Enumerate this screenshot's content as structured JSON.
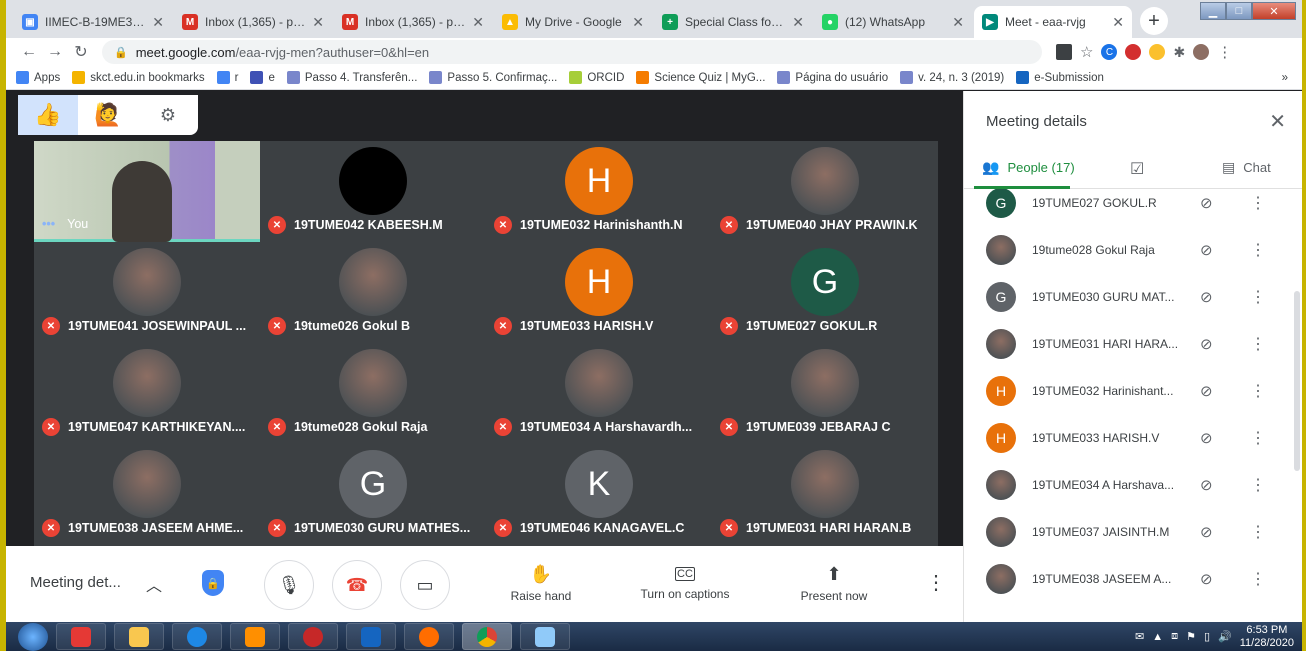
{
  "tabs": [
    {
      "label": "IIMEC-B-19ME302-",
      "color": "#4285f4",
      "glyph": "▣"
    },
    {
      "label": "Inbox (1,365) - prin",
      "color": "#d93025",
      "glyph": "M"
    },
    {
      "label": "Inbox (1,365) - prin",
      "color": "#d93025",
      "glyph": "M"
    },
    {
      "label": "My Drive - Google",
      "color": "#fbbc04",
      "glyph": "▲"
    },
    {
      "label": "Special Class for La",
      "color": "#0f9d58",
      "glyph": "+"
    },
    {
      "label": "(12) WhatsApp",
      "color": "#25d366",
      "glyph": "●"
    },
    {
      "label": "Meet - eaa-rvjg",
      "color": "#00897b",
      "glyph": "▶"
    }
  ],
  "address": {
    "host": "meet.google.com",
    "path": "/eaa-rvjg-men?authuser=0&hl=en"
  },
  "bookmarks": [
    {
      "label": "Apps",
      "color": "#4285f4"
    },
    {
      "label": "skct.edu.in bookmarks",
      "color": "#f4b400"
    },
    {
      "label": "r",
      "color": "#4285f4"
    },
    {
      "label": "e",
      "color": "#3f51b5"
    },
    {
      "label": "Passo 4. Transferên...",
      "color": "#7986cb"
    },
    {
      "label": "Passo 5. Confirmaç...",
      "color": "#7986cb"
    },
    {
      "label": "ORCID",
      "color": "#a6ce39"
    },
    {
      "label": "Science Quiz | MyG...",
      "color": "#f57c00"
    },
    {
      "label": "Página do usuário",
      "color": "#7986cb"
    },
    {
      "label": "v. 24, n. 3 (2019)",
      "color": "#7986cb"
    },
    {
      "label": "e-Submission",
      "color": "#1565c0"
    }
  ],
  "bookmarks_more": "»",
  "self_tile": {
    "label": "You",
    "dots": "•••"
  },
  "tiles": [
    {
      "name": "19TUME042 KABEESH.M",
      "avatar": "",
      "color": "#000000",
      "photo": false
    },
    {
      "name": "19TUME032 Harinishanth.N",
      "avatar": "H",
      "color": "#e8710a",
      "photo": false
    },
    {
      "name": "19TUME040 JHAY PRAWIN.K",
      "avatar": "",
      "color": "",
      "photo": true
    },
    {
      "name": "19TUME041 JOSEWINPAUL ...",
      "avatar": "",
      "color": "",
      "photo": true
    },
    {
      "name": "19tume026 Gokul B",
      "avatar": "",
      "color": "",
      "photo": true
    },
    {
      "name": "19TUME033 HARISH.V",
      "avatar": "H",
      "color": "#e8710a",
      "photo": false
    },
    {
      "name": "19TUME027 GOKUL.R",
      "avatar": "G",
      "color": "#1e5a47",
      "photo": false
    },
    {
      "name": "19TUME047 KARTHIKEYAN....",
      "avatar": "",
      "color": "",
      "photo": true
    },
    {
      "name": "19tume028 Gokul Raja",
      "avatar": "",
      "color": "",
      "photo": true
    },
    {
      "name": "19TUME034 A Harshavardh...",
      "avatar": "",
      "color": "",
      "photo": true
    },
    {
      "name": "19TUME039 JEBARAJ C",
      "avatar": "",
      "color": "",
      "photo": true
    },
    {
      "name": "19TUME038 JASEEM AHME...",
      "avatar": "",
      "color": "",
      "photo": true
    },
    {
      "name": "19TUME030 GURU MATHES...",
      "avatar": "G",
      "color": "#5f6368",
      "photo": false
    },
    {
      "name": "19TUME046 KANAGAVEL.C",
      "avatar": "K",
      "color": "#5f6368",
      "photo": false
    },
    {
      "name": "19TUME031 HARI HARAN.B",
      "avatar": "",
      "color": "",
      "photo": true
    }
  ],
  "controls": {
    "meeting_details": "Meeting det...",
    "raise_hand": "Raise hand",
    "captions": "Turn on captions",
    "present": "Present now"
  },
  "panel": {
    "title": "Meeting details",
    "people_tab": "People (17)",
    "chat_tab": "Chat",
    "people": [
      {
        "name": "19TUME027 GOKUL.R",
        "avatar": "G",
        "color": "#1e5a47",
        "photo": false
      },
      {
        "name": "19tume028 Gokul Raja",
        "avatar": "",
        "color": "",
        "photo": true
      },
      {
        "name": "19TUME030 GURU MAT...",
        "avatar": "G",
        "color": "#5f6368",
        "photo": false
      },
      {
        "name": "19TUME031 HARI HARA...",
        "avatar": "",
        "color": "",
        "photo": true
      },
      {
        "name": "19TUME032 Harinishant...",
        "avatar": "H",
        "color": "#e8710a",
        "photo": false
      },
      {
        "name": "19TUME033 HARISH.V",
        "avatar": "H",
        "color": "#e8710a",
        "photo": false
      },
      {
        "name": "19TUME034 A Harshava...",
        "avatar": "",
        "color": "",
        "photo": true
      },
      {
        "name": "19TUME037 JAISINTH.M",
        "avatar": "",
        "color": "",
        "photo": true
      },
      {
        "name": "19TUME038 JASEEM A...",
        "avatar": "",
        "color": "",
        "photo": true
      }
    ]
  },
  "taskbar": {
    "time": "6:53 PM",
    "date": "11/28/2020"
  }
}
